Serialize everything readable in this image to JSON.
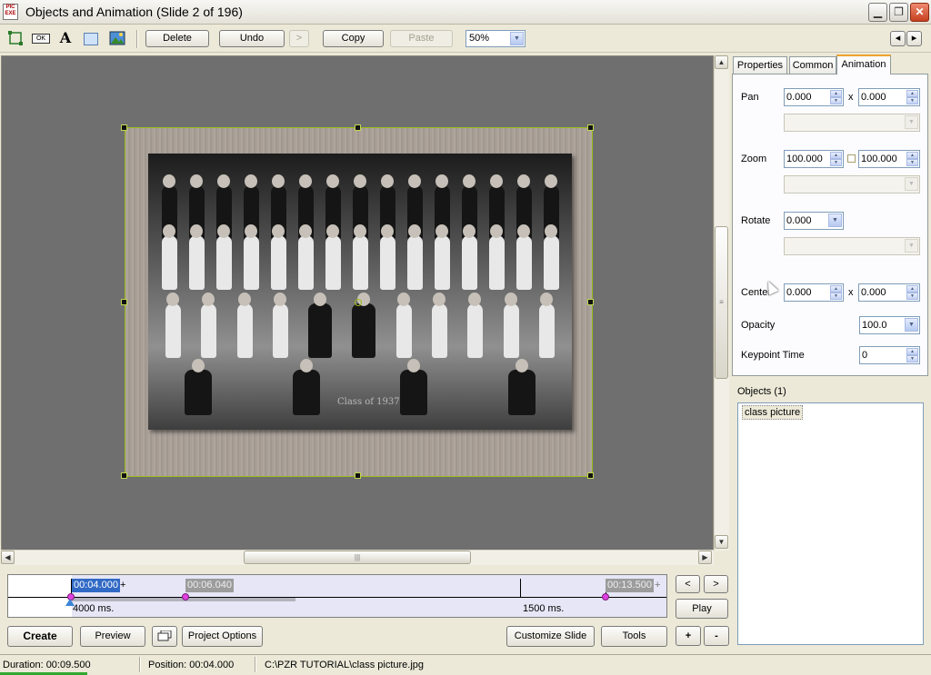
{
  "window": {
    "app_icon_text": "PIC EXE",
    "title": "Objects and Animation  (Slide 2 of 196)",
    "minimize_glyph": "▁",
    "restore_glyph": "❐",
    "close_glyph": "✕"
  },
  "toolbar": {
    "icons": [
      "frame-icon",
      "button-ok-icon",
      "text-icon",
      "rectangle-icon",
      "image-icon"
    ],
    "ok_icon_text": "OK",
    "text_icon_text": "A",
    "delete_label": "Delete",
    "undo_label": "Undo",
    "redo_label": ">",
    "copy_label": "Copy",
    "paste_label": "Paste",
    "zoom_value": "50%",
    "prev_glyph": "◂",
    "next_glyph": "▸"
  },
  "canvas": {
    "object_name": "class picture",
    "photo_caption": "Class  of  1937"
  },
  "timeline": {
    "marker_current": "00:04.000",
    "marker_next": "00:06.040",
    "marker_end": "00:13.500",
    "plus": "+",
    "duration_left": "4000 ms.",
    "duration_right": "1500 ms.",
    "nav_prev": "<",
    "nav_next": ">",
    "play_label": "Play"
  },
  "bottom_buttons": {
    "create": "Create",
    "preview": "Preview",
    "project_options": "Project Options",
    "customize_slide": "Customize Slide",
    "tools": "Tools",
    "add": "+",
    "remove": "-"
  },
  "tabs": [
    "Properties",
    "Common",
    "Animation"
  ],
  "animation": {
    "pan_label": "Pan",
    "pan_x": "0.000",
    "pan_y": "0.000",
    "zoom_label": "Zoom",
    "zoom_x": "100.000",
    "zoom_y": "100.000",
    "rotate_label": "Rotate",
    "rotate_value": "0.000",
    "center_label": "Center",
    "center_x": "0.000",
    "center_y": "0.000",
    "opacity_label": "Opacity",
    "opacity_value": "100.0",
    "keypoint_label": "Keypoint Time",
    "keypoint_value": "0",
    "x_sep": "x"
  },
  "objects": {
    "header": "Objects (1)",
    "items": [
      "class picture"
    ]
  },
  "status": {
    "duration": "Duration:  00:09.500",
    "position": "Position:  00:04.000",
    "path": "C:\\PZR TUTORIAL\\class picture.jpg"
  }
}
